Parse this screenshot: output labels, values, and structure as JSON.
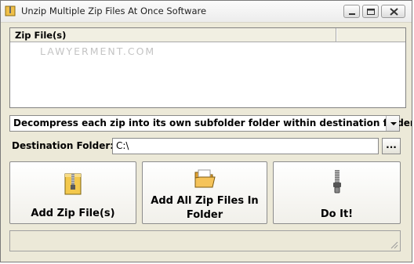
{
  "window": {
    "title": "Unzip Multiple Zip Files At Once Software"
  },
  "list": {
    "column_header": "Zip File(s)",
    "watermark": "LAWYERMENT.COM",
    "items": []
  },
  "mode_select": {
    "selected": "Decompress each zip into its own subfolder folder within destination folder"
  },
  "destination": {
    "label": "Destination Folder:",
    "value": "C:\\",
    "browse_label": "..."
  },
  "buttons": {
    "add_zip": "Add Zip File(s)",
    "add_folder_line1": "Add All Zip Files In",
    "add_folder_line2": "Folder",
    "do_it": "Do It!"
  },
  "status": {
    "text": ""
  },
  "icons": {
    "app": "zip-app-icon",
    "add_zip": "zip-file-icon",
    "add_folder": "open-folder-icon",
    "do_it": "zipper-icon"
  }
}
